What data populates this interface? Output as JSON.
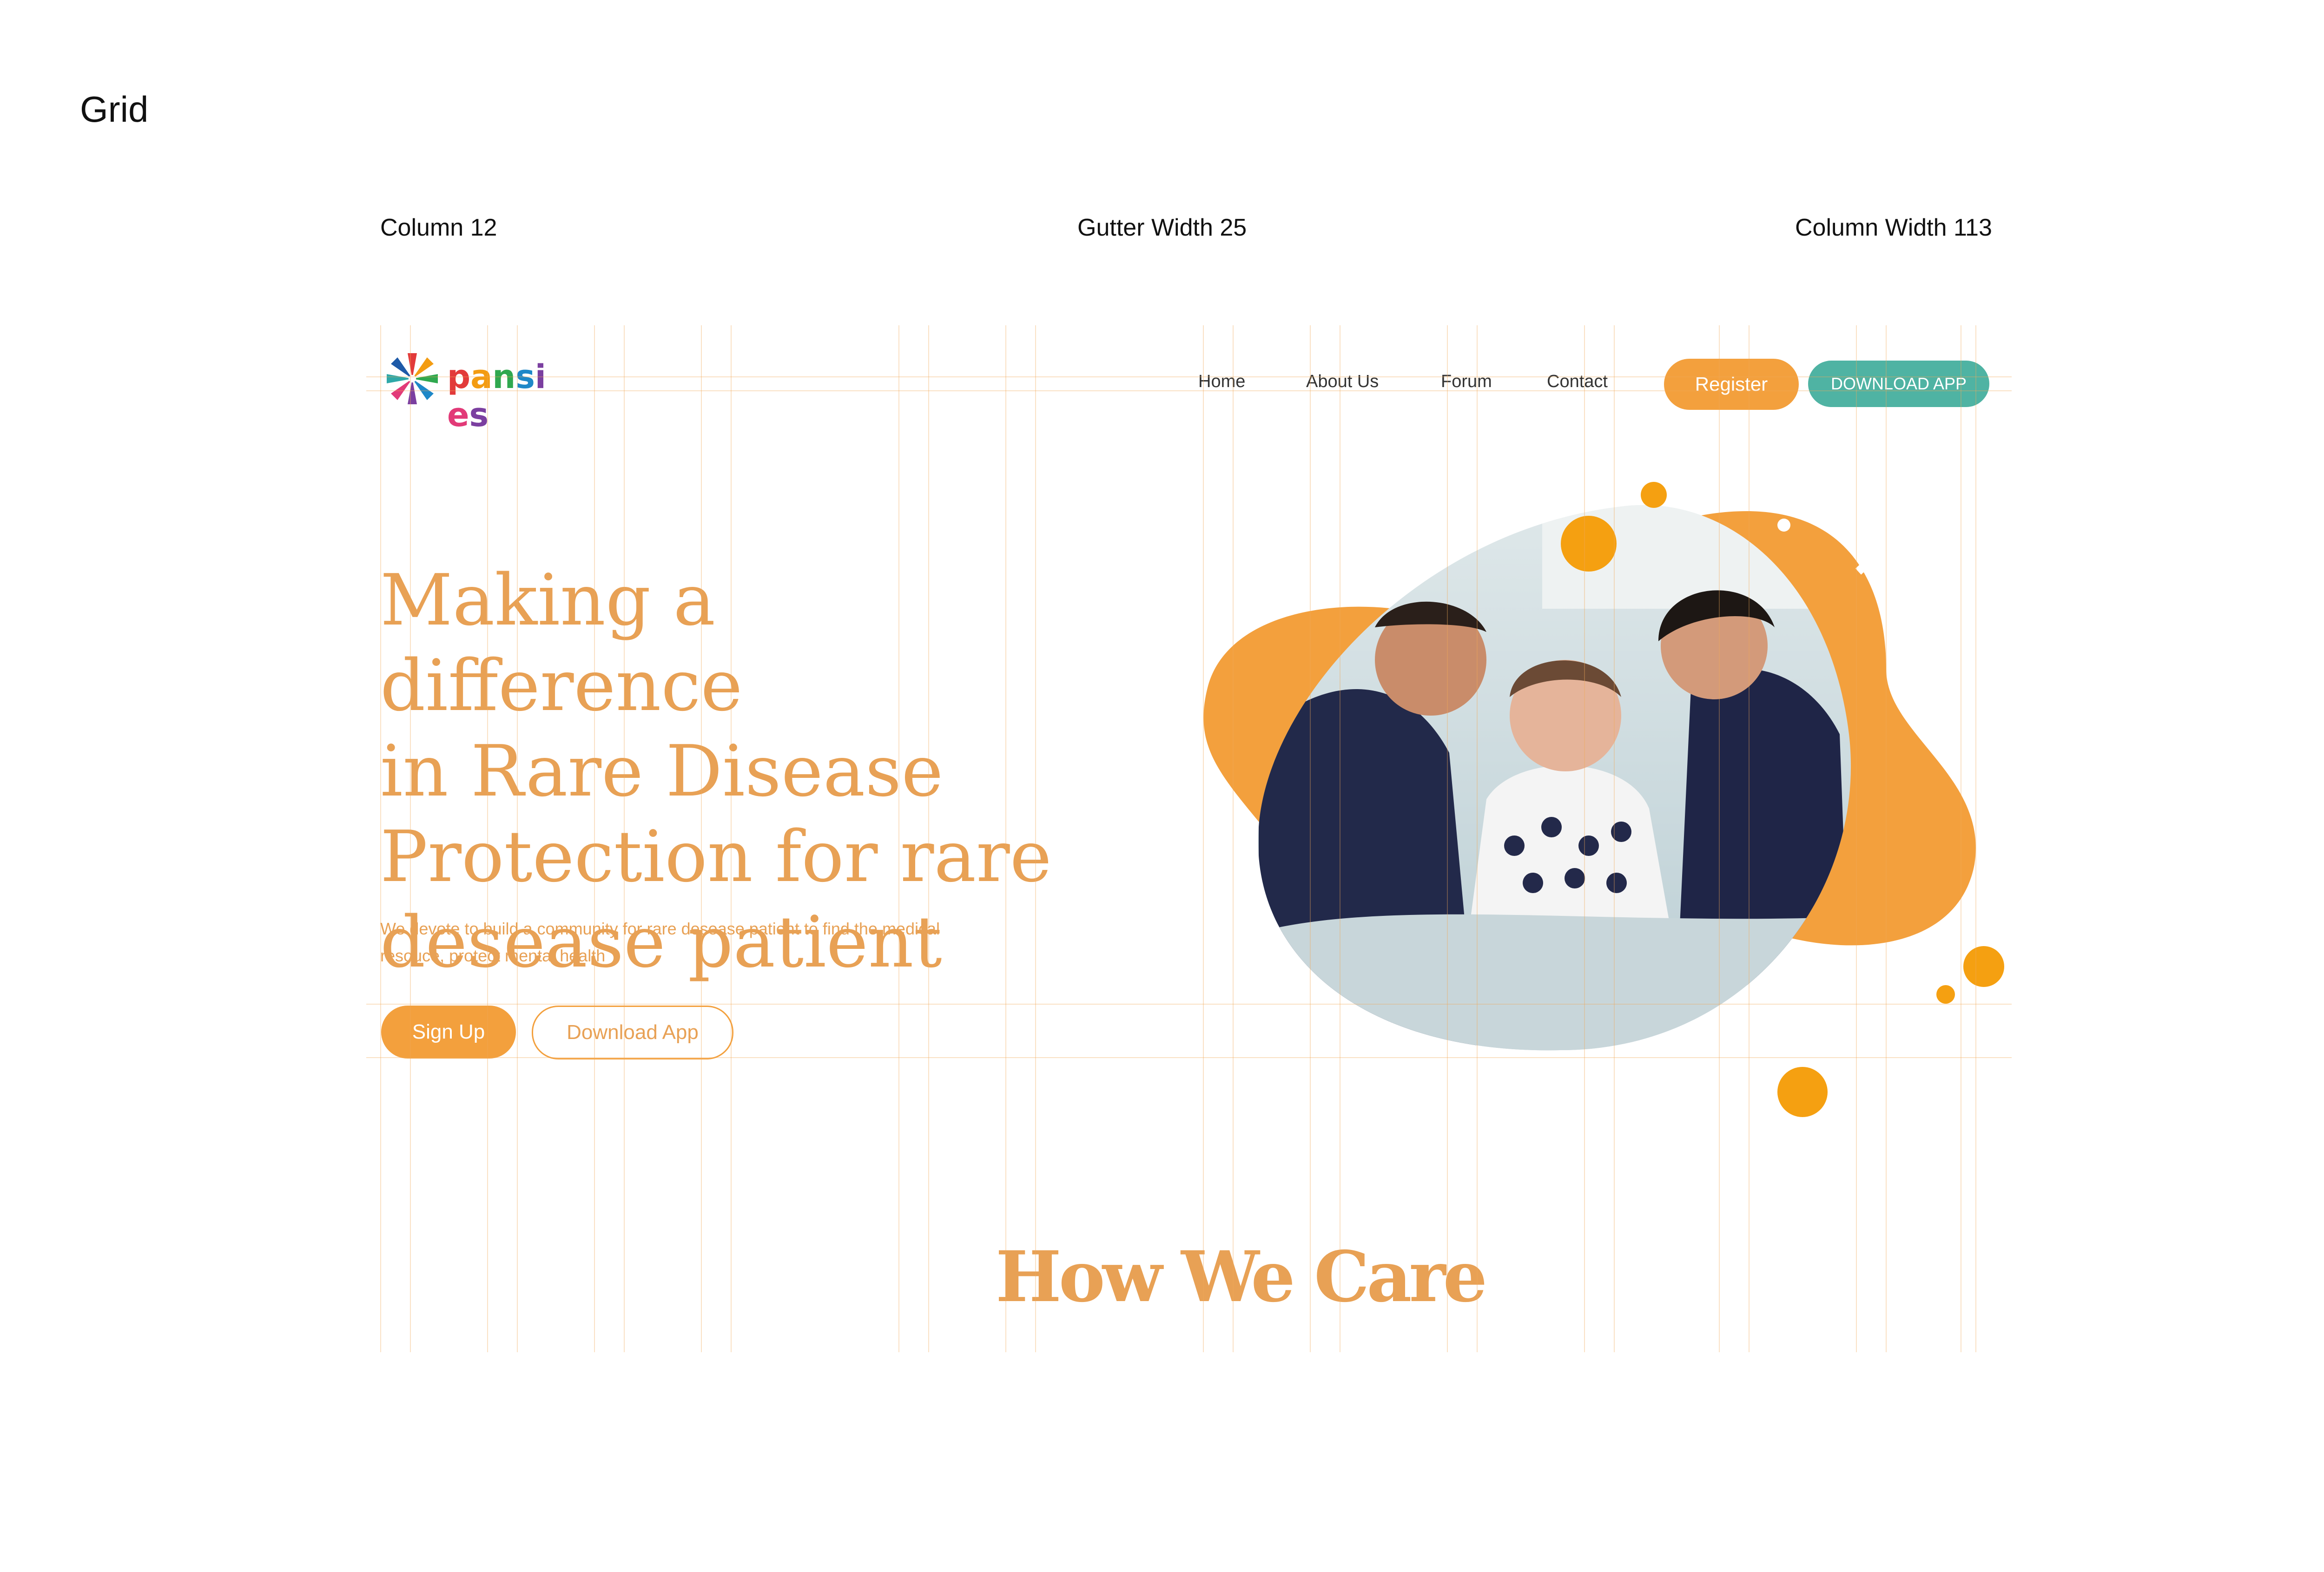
{
  "page": {
    "title": "Grid"
  },
  "specs": {
    "columns": "Column 12",
    "gutter": "Gutter Width 25",
    "column_width": "Column Width 113"
  },
  "brand": {
    "name_letters": [
      "p",
      "a",
      "n",
      "s",
      "i",
      "e",
      "s"
    ],
    "name_colors": [
      "#e23a3a",
      "#f39c12",
      "#2fa84f",
      "#1e88c8",
      "#7b3fa0",
      "#e23a78",
      "#7b3fa0"
    ],
    "icon": "flower-logo-icon"
  },
  "nav": {
    "items": [
      {
        "label": "Home"
      },
      {
        "label": "About Us"
      },
      {
        "label": "Forum"
      },
      {
        "label": "Contact"
      }
    ],
    "register_label": "Register",
    "download_label": "DOWNLOAD APP"
  },
  "hero": {
    "title_lines": [
      "Making a difference",
      "in Rare Disease",
      "Protection for rare",
      "desease patient"
    ],
    "subtitle_lines": [
      "We devote to build a community for rare desease patient to find the medical",
      "resouce, protect mental health"
    ],
    "signup_label": "Sign Up",
    "download_label": "Download App",
    "image_icon": "family-photo-blob"
  },
  "section": {
    "title": "How We Care"
  },
  "colors": {
    "accent": "#f3a03d",
    "accent_text": "#e8a155",
    "teal": "#4fb3a3",
    "grid": "#f0aa5a"
  }
}
